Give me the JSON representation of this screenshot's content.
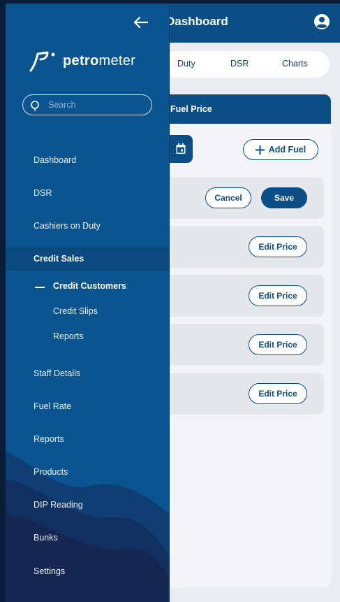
{
  "header": {
    "title": "Dashboard",
    "avatar_icon": "user-circle-icon"
  },
  "tabs": [
    {
      "label": "Duty"
    },
    {
      "label": "DSR"
    },
    {
      "label": "Charts"
    }
  ],
  "panel": {
    "title": "Fuel Price",
    "date_icon": "calendar-icon",
    "add_fuel_label": "Add Fuel",
    "cancel_label": "Cancel",
    "save_label": "Save",
    "edit_label": "Edit Price"
  },
  "drawer": {
    "back_icon": "arrow-left-icon",
    "logo": {
      "bold": "petro",
      "light": "meter",
      "icon": "petrometer-logo-icon"
    },
    "search_placeholder": "Search",
    "menu": [
      {
        "label": "Dashboard"
      },
      {
        "label": "DSR"
      },
      {
        "label": "Cashiers on Duty"
      },
      {
        "label": "Credit Sales",
        "active": true
      },
      {
        "label": "Staff Details"
      },
      {
        "label": "Fuel Rate"
      },
      {
        "label": "Reports"
      },
      {
        "label": "Products"
      },
      {
        "label": "DIP Reading"
      },
      {
        "label": "Bunks"
      },
      {
        "label": "Settings"
      }
    ],
    "credit_sub": [
      {
        "label": "Credit Customers",
        "active": true
      },
      {
        "label": "Credit Slips"
      },
      {
        "label": "Reports"
      }
    ]
  },
  "colors": {
    "primary": "#0a4e85",
    "drawer": "#0a5590",
    "drawer_active": "#0b4a7e",
    "background": "#e9edf2"
  }
}
